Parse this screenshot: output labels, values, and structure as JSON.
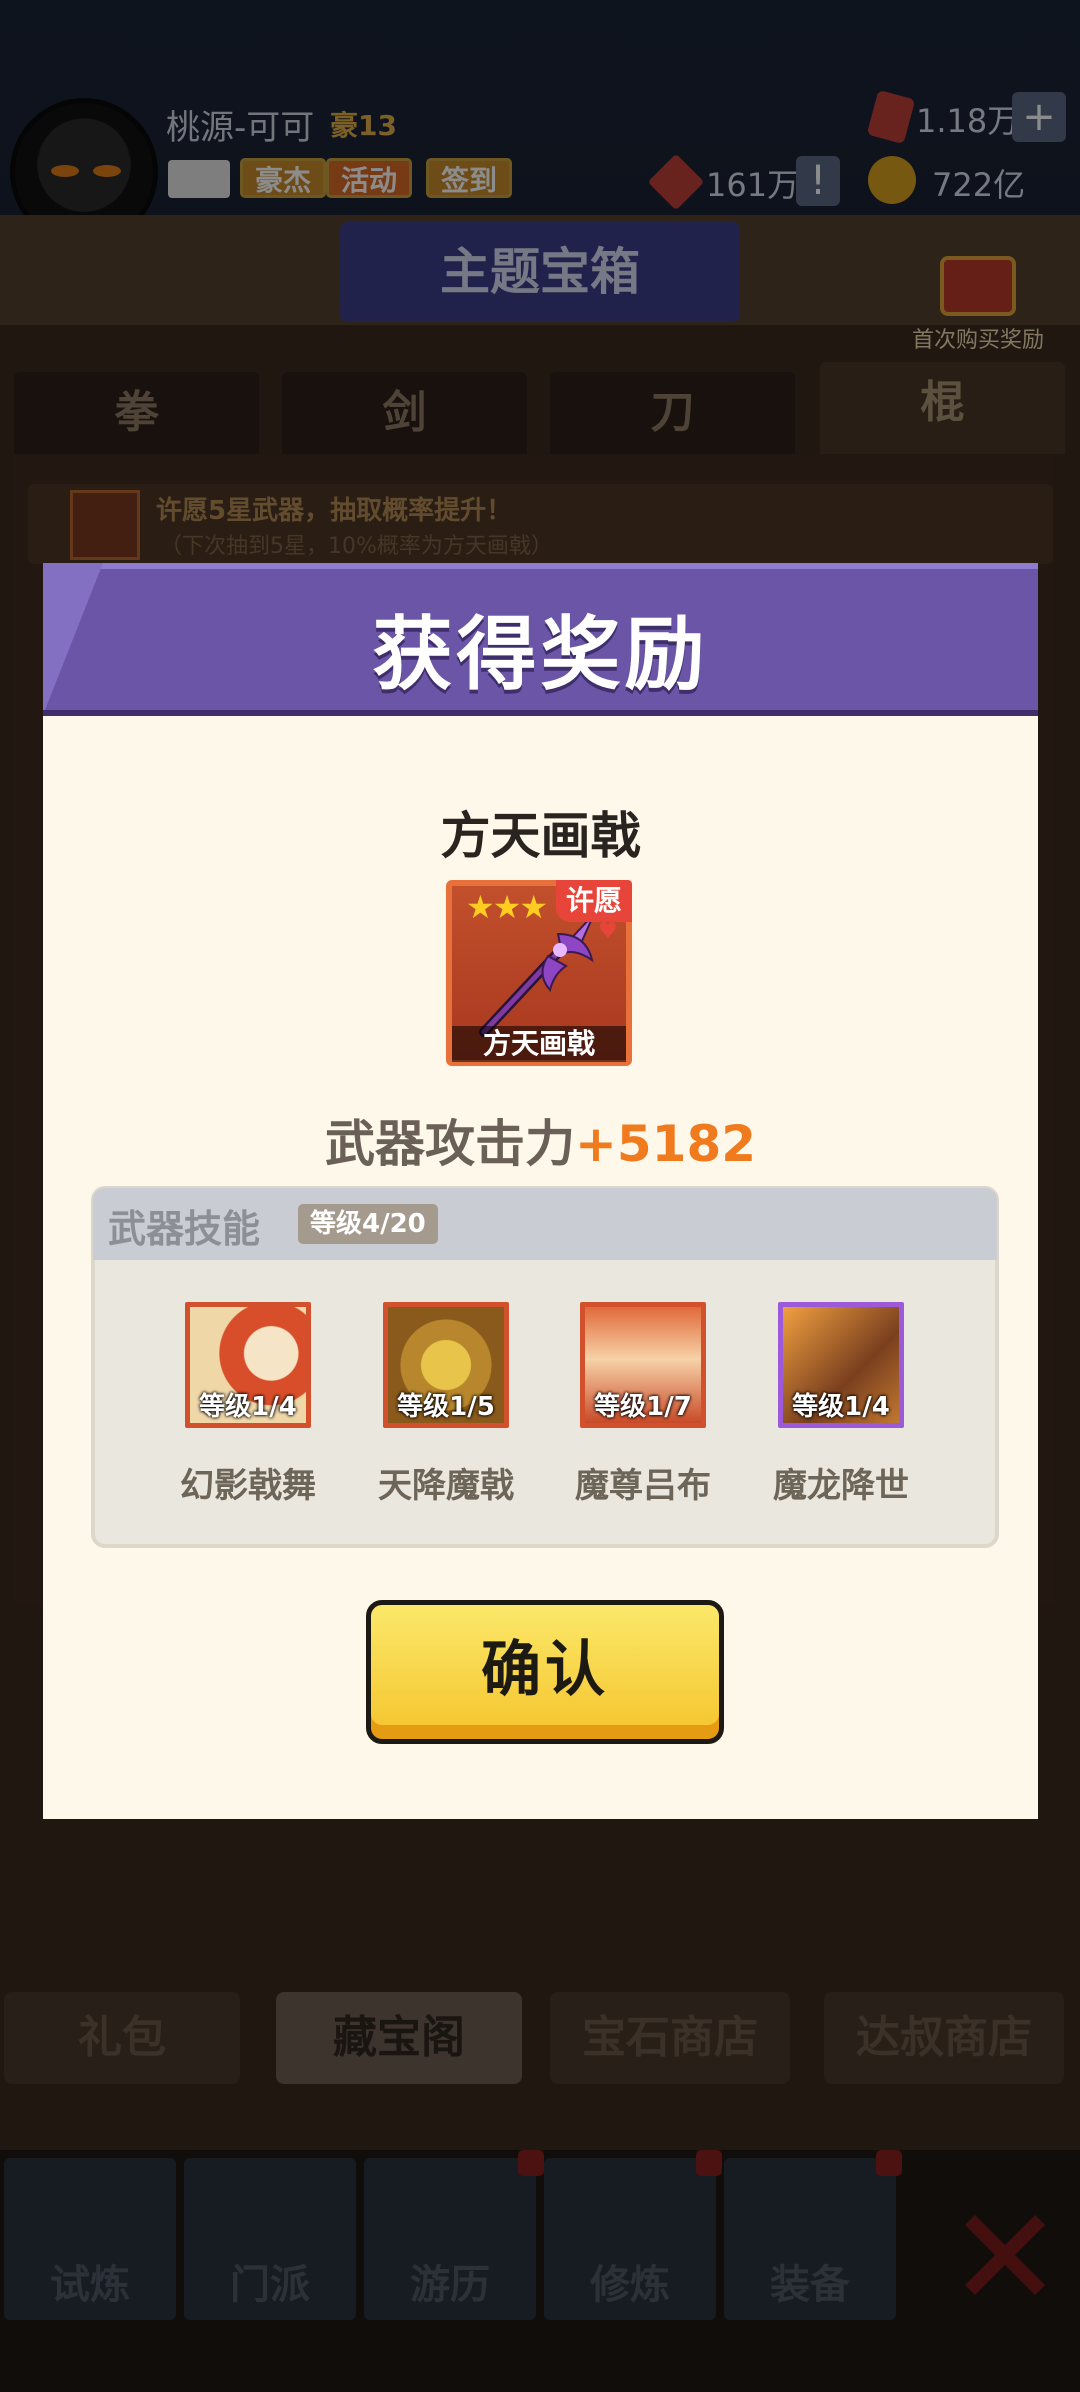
{
  "player": {
    "name": "桃源-可可",
    "level": "豪13",
    "buttons": [
      "豪杰",
      "活动",
      "签到"
    ],
    "gems": "1.18万",
    "tokens": "161万",
    "coins": "722亿"
  },
  "shop": {
    "title": "主题宝箱",
    "first_purchase": "首次购买奖励",
    "weapon_tabs": [
      "拳",
      "剑",
      "刀",
      "棍"
    ],
    "promo_text": "许愿5星武器，抽取概率提升！",
    "promo_sub": "（下次抽到5星，10%概率为方天画戟）",
    "store_tabs": [
      "礼包",
      "藏宝阁",
      "宝石商店",
      "达叔商店"
    ]
  },
  "nav": {
    "items": [
      "试炼",
      "门派",
      "游历",
      "修炼",
      "装备"
    ]
  },
  "modal": {
    "title": "获得奖励",
    "item_name": "方天画戟",
    "item_card_label": "方天画戟",
    "wish_tag": "许愿",
    "stars": "★★★",
    "attack_label": "武器攻击力",
    "attack_value": "+5182",
    "skills_title": "武器技能",
    "skills_level": "等级4/20",
    "skills": [
      {
        "name": "幻影戟舞",
        "level": "等级1/4"
      },
      {
        "name": "天降魔戟",
        "level": "等级1/5"
      },
      {
        "name": "魔尊吕布",
        "level": "等级1/7"
      },
      {
        "name": "魔龙降世",
        "level": "等级1/4"
      }
    ],
    "confirm_label": "确认"
  },
  "colors": {
    "header": "#6b55a6",
    "modal_bg": "#fdf8ea",
    "attack_value": "#f07a1e",
    "confirm": "#f5c42c"
  }
}
